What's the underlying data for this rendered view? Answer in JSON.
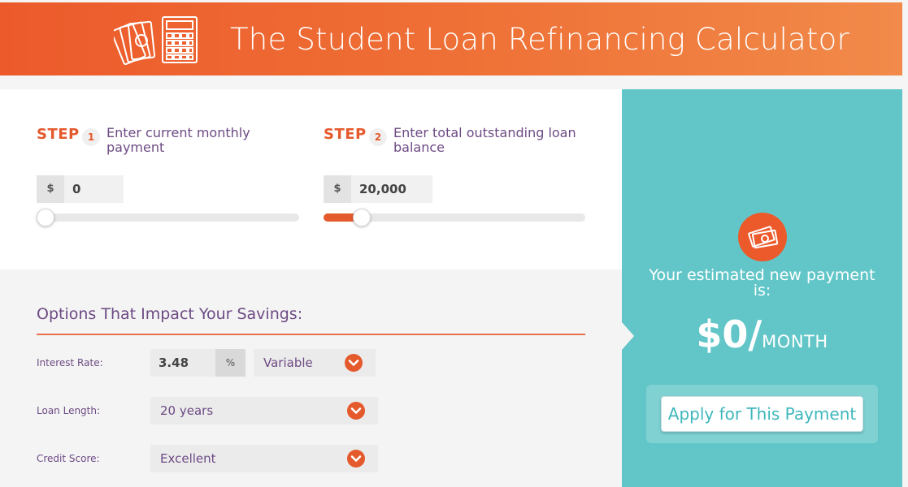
{
  "header": {
    "title": "The Student Loan Refinancing Calculator",
    "icons": [
      "money-icon",
      "calculator-icon"
    ]
  },
  "steps": [
    {
      "word": "STEP",
      "number": "1",
      "text": "Enter current monthly payment",
      "currency": "$",
      "value": "0",
      "slider_fraction": 0.0
    },
    {
      "word": "STEP",
      "number": "2",
      "text": "Enter total outstanding loan balance",
      "currency": "$",
      "value": "20,000",
      "slider_fraction": 0.12
    }
  ],
  "options": {
    "title": "Options That Impact Your Savings:",
    "interest_rate": {
      "label": "Interest Rate:",
      "value": "3.48",
      "unit": "%",
      "type": "Variable"
    },
    "loan_length": {
      "label": "Loan Length:",
      "value": "20 years"
    },
    "credit_score": {
      "label": "Credit Score:",
      "value": "Excellent"
    }
  },
  "result": {
    "label": "Your estimated new payment is:",
    "amount": "$0/",
    "period": "MONTH",
    "apply_label": "Apply for This Payment",
    "icon": "money-icon"
  },
  "colors": {
    "accent": "#e55a2d",
    "purple": "#6d4a84",
    "teal": "#62c6c8"
  }
}
